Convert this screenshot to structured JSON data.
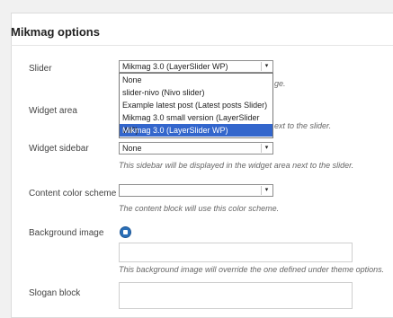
{
  "panel": {
    "title": "Mikmag options"
  },
  "fields": {
    "slider": {
      "label": "Slider",
      "value": "Mikmag 3.0 (LayerSlider WP)",
      "desc_visible_tail": "ge.",
      "options": [
        "None",
        "slider-nivo (Nivo slider)",
        "Example latest post (Latest posts Slider)",
        "Mikmag 3.0 small version (LayerSlider WP)",
        "Mikmag 3.0 (LayerSlider WP)"
      ],
      "selected_index": 4
    },
    "widget_area": {
      "label": "Widget area",
      "desc_visible_tail": "ext to the slider."
    },
    "widget_sidebar": {
      "label": "Widget sidebar",
      "value": "None",
      "desc": "This sidebar will be displayed in the widget area next to the slider."
    },
    "content_color_scheme": {
      "label": "Content color scheme",
      "value": "",
      "desc": "The content block will use this color scheme."
    },
    "background_image": {
      "label": "Background image",
      "desc": "This background image will override the one defined under theme options."
    },
    "slogan_block": {
      "label": "Slogan block"
    }
  },
  "icons": {
    "arrow": "▾",
    "upload": "upload-icon"
  },
  "colors": {
    "selected_bg": "#3366cc",
    "icon_blue": "#2a6fb8"
  }
}
